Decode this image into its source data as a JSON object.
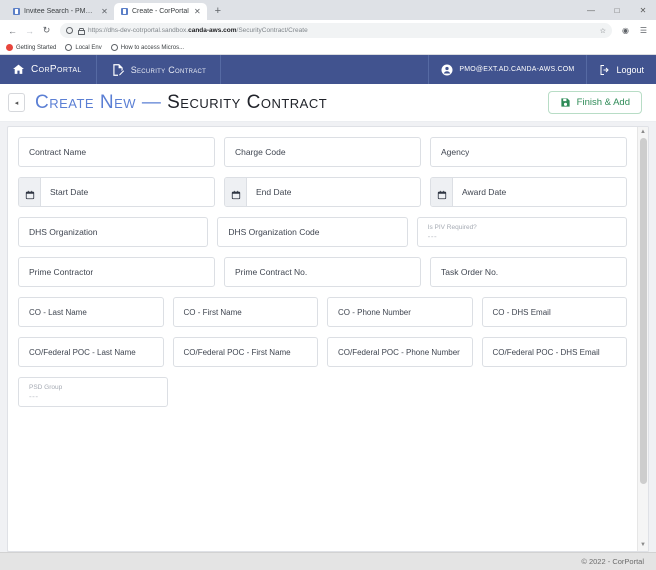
{
  "browser": {
    "tabs": [
      {
        "title": "Invitee Search - PMPortal",
        "active": false
      },
      {
        "title": "Create - CorPortal",
        "active": true
      }
    ],
    "new_tab_label": "+",
    "window_controls": {
      "minimize": "—",
      "maximize": "□",
      "close": "✕"
    },
    "nav": {
      "back": "←",
      "forward": "→",
      "reload": "↻"
    },
    "url": {
      "prefix": "https://dhs-dev-cotrportal.sandbox.",
      "domain": "canda-aws.com",
      "path": "/SecurityContract/Create"
    },
    "star_icon": "☆",
    "bookmarks": [
      {
        "label": "Getting Started",
        "icon": "app-icon"
      },
      {
        "label": "Local Env",
        "icon": "globe-icon"
      },
      {
        "label": "How to access Micros...",
        "icon": "globe-icon"
      }
    ]
  },
  "app": {
    "brand": "CorPortal",
    "module": "Security Contract",
    "user_email": "PMO@EXT.AD.CANDA-AWS.COM",
    "logout_label": "Logout",
    "header_bg": "#41538f"
  },
  "page": {
    "back_label": "◂",
    "title_accent": "Create New",
    "title_dash": "—",
    "title_rest": "Security Contract",
    "finish_label": "Finish & Add",
    "finish_color": "#2e8b57"
  },
  "form": {
    "rows": [
      {
        "type": "text3",
        "fields": [
          {
            "label": "Contract Name"
          },
          {
            "label": "Charge Code"
          },
          {
            "label": "Agency"
          }
        ]
      },
      {
        "type": "date3",
        "fields": [
          {
            "label": "Start Date"
          },
          {
            "label": "End Date"
          },
          {
            "label": "Award Date"
          }
        ]
      },
      {
        "type": "mixed3",
        "fields": [
          {
            "label": "DHS Organization",
            "kind": "text"
          },
          {
            "label": "DHS Organization Code",
            "kind": "text"
          },
          {
            "label": "Is PIV Required?",
            "kind": "select",
            "value": "---"
          }
        ]
      },
      {
        "type": "text3",
        "fields": [
          {
            "label": "Prime Contractor"
          },
          {
            "label": "Prime Contract No."
          },
          {
            "label": "Task Order No."
          }
        ]
      },
      {
        "type": "text4",
        "fields": [
          {
            "label": "CO - Last Name"
          },
          {
            "label": "CO - First Name"
          },
          {
            "label": "CO - Phone Number"
          },
          {
            "label": "CO - DHS Email"
          }
        ]
      },
      {
        "type": "text4",
        "fields": [
          {
            "label": "CO/Federal POC - Last Name"
          },
          {
            "label": "CO/Federal POC - First Name"
          },
          {
            "label": "CO/Federal POC - Phone Number"
          },
          {
            "label": "CO/Federal POC - DHS Email"
          }
        ]
      },
      {
        "type": "select1",
        "fields": [
          {
            "label": "PSD Group",
            "kind": "select",
            "value": "---"
          }
        ]
      }
    ]
  },
  "footer": {
    "copyright": "© 2022 - CorPortal"
  },
  "scrollbar": {
    "up": "▲",
    "down": "▼"
  }
}
